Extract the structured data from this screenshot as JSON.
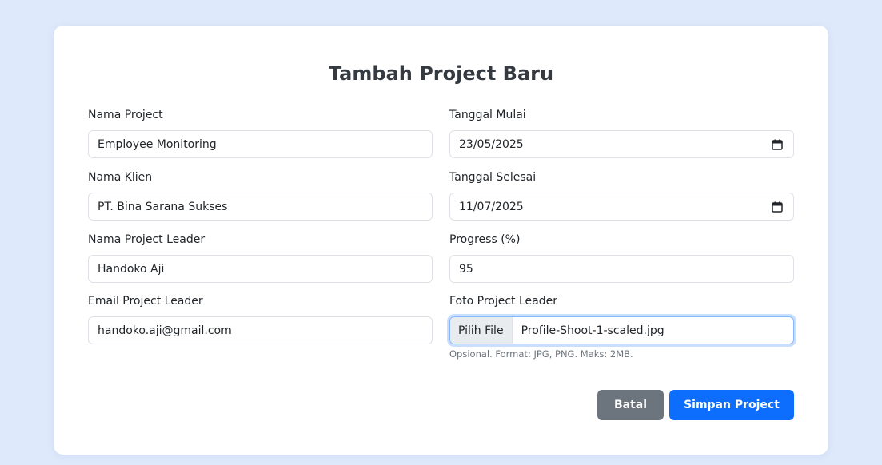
{
  "form": {
    "title": "Tambah Project Baru",
    "nama_project": {
      "label": "Nama Project",
      "value": "Employee Monitoring"
    },
    "nama_klien": {
      "label": "Nama Klien",
      "value": "PT. Bina Sarana Sukses"
    },
    "nama_leader": {
      "label": "Nama Project Leader",
      "value": "Handoko Aji"
    },
    "email_leader": {
      "label": "Email Project Leader",
      "value": "handoko.aji@gmail.com"
    },
    "tanggal_mulai": {
      "label": "Tanggal Mulai",
      "value": "23/05/2025"
    },
    "tanggal_selesai": {
      "label": "Tanggal Selesai",
      "value": "11/07/2025"
    },
    "progress": {
      "label": "Progress (%)",
      "value": "95"
    },
    "foto_leader": {
      "label": "Foto Project Leader",
      "button": "Pilih File",
      "file_name": "Profile-Shoot-1-scaled.jpg",
      "help": "Opsional. Format: JPG, PNG. Maks: 2MB."
    },
    "buttons": {
      "cancel": "Batal",
      "save": "Simpan Project"
    }
  },
  "colors": {
    "background": "#dfe9fc",
    "primary": "#0d6efd",
    "secondary": "#6c757d"
  },
  "icons": {
    "date_picker": "calendar-icon"
  }
}
